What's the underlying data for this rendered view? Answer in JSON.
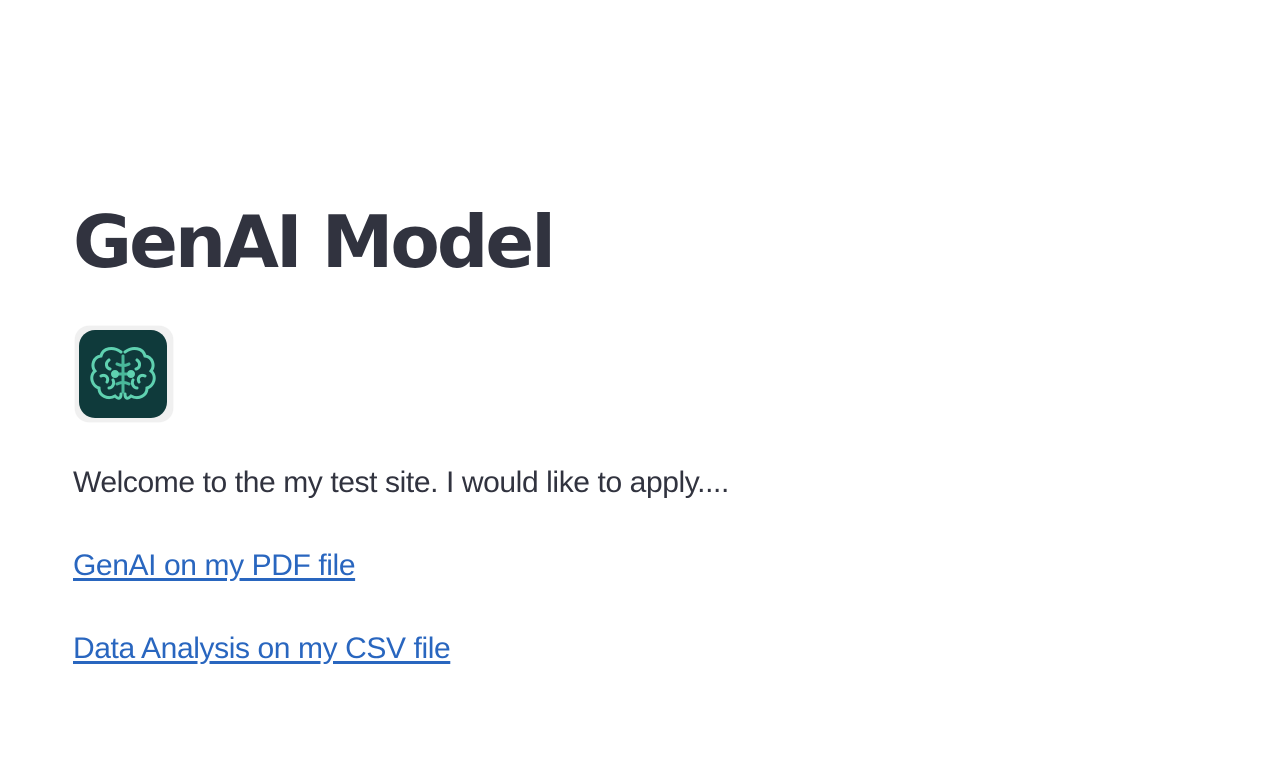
{
  "page": {
    "title": "GenAI Model",
    "welcome_text": "Welcome to the my test site. I would like to apply....",
    "links": [
      {
        "label": "GenAI on my PDF file"
      },
      {
        "label": "Data Analysis on my CSV file"
      }
    ]
  },
  "logo": {
    "icon": "brain-icon",
    "background_color": "#0f3a3b",
    "accent_color": "#5fd1b0"
  },
  "colors": {
    "text": "#31333f",
    "link": "#2966bf"
  }
}
